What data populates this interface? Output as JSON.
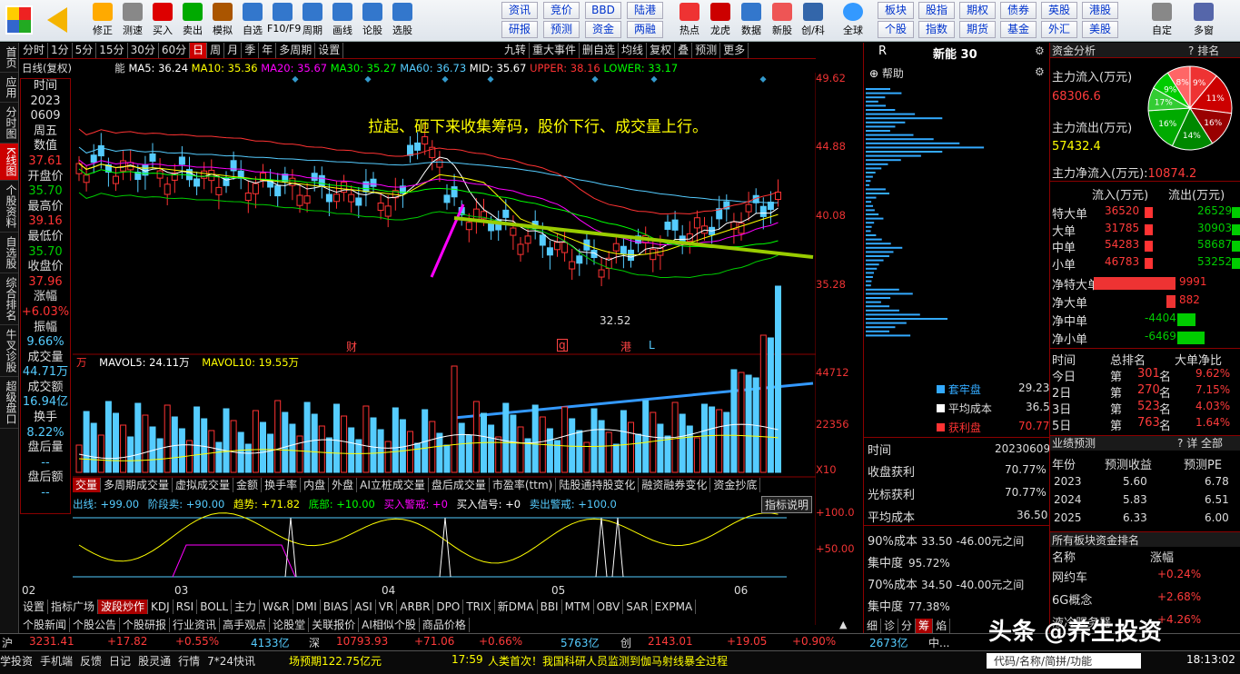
{
  "toolbar": {
    "buttons": [
      "修正",
      "测速",
      "买入",
      "卖出",
      "模拟",
      "自选",
      "F10/F9",
      "周期",
      "画线",
      "论股",
      "选股"
    ],
    "grid": [
      [
        "资讯",
        "竞价",
        "BBD",
        "陆港"
      ],
      [
        "研报",
        "预测",
        "资金",
        "两融"
      ]
    ],
    "right_buttons": [
      "热点",
      "龙虎",
      "数据",
      "新股",
      "创/科"
    ],
    "grid2": [
      [
        "板块",
        "股指",
        "期权",
        "债券",
        "英股",
        "港股"
      ],
      [
        "个股",
        "指数",
        "期货",
        "基金",
        "外汇",
        "美股"
      ]
    ],
    "far": [
      "全球",
      "自定",
      "多窗"
    ]
  },
  "leftnav": [
    "首页",
    "应用",
    "分时图",
    "K线图",
    "个股资料",
    "自选股",
    "综合排名",
    "牛叉诊股",
    "超级盘口"
  ],
  "stats": {
    "time_label": "时间",
    "year": "2023",
    "date": "0609",
    "weekday": "周五",
    "close_label": "数值",
    "close_val": "37.61",
    "open_label": "开盘价",
    "open_val": "35.70",
    "high_label": "最高价",
    "high_val": "39.16",
    "low_label": "最低价",
    "low_val": "35.70",
    "cls_label": "收盘价",
    "cls_val": "37.96",
    "chg_label": "涨幅",
    "chg_val": "+6.03%",
    "amp_label": "振幅",
    "amp_val": "9.66%",
    "vol_label": "成交量",
    "vol_val": "44.71万",
    "amt_label": "成交额",
    "amt_val": "16.94亿",
    "turn_label": "换手",
    "turn_val": "8.22%",
    "after_vol_label": "盘后量",
    "after_vol_val": "--",
    "after_amt_label": "盘后额",
    "after_amt_val": "--"
  },
  "period_tabs": [
    "分时",
    "1分",
    "5分",
    "15分",
    "30分",
    "60分",
    "日",
    "周",
    "月",
    "季",
    "年",
    "多周期",
    "设置"
  ],
  "right_tabs": [
    "九转",
    "重大事件",
    "删自选",
    "均线",
    "复权",
    "叠",
    "预测",
    "更多"
  ],
  "ma_line": {
    "prefix": "日线(复权)",
    "name": "能",
    "ma5": "MA5: 36.24",
    "ma10": "MA10: 35.36",
    "ma20": "MA20: 35.67",
    "ma30": "MA30: 35.27",
    "ma60": "MA60: 36.73",
    "mid": "MID: 35.67",
    "upper": "UPPER: 38.16",
    "lower": "LOWER: 33.17"
  },
  "price_axis": [
    "49.62",
    "44.88",
    "40.08",
    "35.28"
  ],
  "annotation": "拉起、砸下来收集筹码，股价下行、成交量上行。",
  "low_mark": "32.52",
  "markers": [
    "财",
    "q",
    "港",
    "L"
  ],
  "vol_line": {
    "unit": "万",
    "mavol5": "MAVOL5: 24.11万",
    "mavol10": "MAVOL10: 19.55万"
  },
  "vol_axis": [
    "44712",
    "22356",
    "X10"
  ],
  "vol_tabs": [
    "交量",
    "多周期成交量",
    "虚拟成交量",
    "金额",
    "换手率",
    "内盘",
    "外盘",
    "AI立桩成交量",
    "盘后成交量",
    "市盈率(ttm)",
    "陆股通持股变化",
    "融资融券变化",
    "资金抄底"
  ],
  "ind_line": {
    "a": "出线: +99.00",
    "b": "阶段卖: +90.00",
    "c": "趋势: +71.82",
    "d": "底部: +10.00",
    "e": "买入警戒: +0",
    "f": "买入信号: +0",
    "g": "卖出警戒: +100.0",
    "btn": "指标说明"
  },
  "ind_axis": [
    "+100.0",
    "+50.00"
  ],
  "months": [
    "02",
    "03",
    "04",
    "05",
    "06"
  ],
  "ind_tabs": [
    "设置",
    "指标广场",
    "波段炒作",
    "KDJ",
    "RSI",
    "BOLL",
    "主力",
    "W&R",
    "DMI",
    "BIAS",
    "ASI",
    "VR",
    "ARBR",
    "DPO",
    "TRIX",
    "新DMA",
    "BBI",
    "MTM",
    "OBV",
    "SAR",
    "EXPMA"
  ],
  "news_tabs": [
    "个股新闻",
    "个股公告",
    "个股研报",
    "行业资讯",
    "高手观点",
    "论股堂",
    "关联报价",
    "AI相似个股",
    "商品价格"
  ],
  "chip": {
    "title": "新能 30",
    "help": "帮助",
    "legend": [
      [
        "套牢盘",
        "29.23%"
      ],
      [
        "平均成本",
        "36.50"
      ],
      [
        "获利盘",
        "70.77%"
      ]
    ],
    "time_label": "时间",
    "time_val": "20230609",
    "p1_label": "收盘获利",
    "p1": "70.77%",
    "p2_label": "光标获利",
    "p2": "70.77%",
    "avg_label": "平均成本",
    "avg": "36.50",
    "c90": "90%成本",
    "c90a": "33.50",
    "c90b": "-46.00元之间",
    "c90c": "集中度",
    "c90d": "95.72%",
    "c70": "70%成本",
    "c70a": "34.50",
    "c70b": "-40.00元之间",
    "c70c": "集中度",
    "c70d": "77.38%"
  },
  "fund": {
    "title": "资金分析",
    "rank": "排名",
    "in_label": "主力流入(万元)",
    "in_val": "68306.6",
    "out_label": "主力流出(万元)",
    "out_val": "57432.4",
    "net_label": "主力净流入(万元):",
    "net_val": "10874.2",
    "pie": [
      "9%",
      "11%",
      "16%",
      "14%",
      "16%",
      "17%",
      "9%",
      "8%"
    ],
    "hdr": [
      "流入(万元)",
      "流出(万元)"
    ],
    "rows": [
      [
        "特大单",
        "36520",
        "26529"
      ],
      [
        "大单",
        "31785",
        "30903"
      ],
      [
        "中单",
        "54283",
        "58687"
      ],
      [
        "小单",
        "46783",
        "53252"
      ]
    ],
    "net": [
      [
        "净特大单",
        "9991"
      ],
      [
        "净大单",
        "882"
      ],
      [
        "净中单",
        "-4404"
      ],
      [
        "净小单",
        "-6469"
      ]
    ],
    "rank_hdr": [
      "时间",
      "总排名",
      "大单净比"
    ],
    "ranks": [
      [
        "今日",
        "第",
        "301",
        "名",
        "9.62%"
      ],
      [
        "2日",
        "第",
        "270",
        "名",
        "7.15%"
      ],
      [
        "3日",
        "第",
        "523",
        "名",
        "4.03%"
      ],
      [
        "5日",
        "第",
        "763",
        "名",
        "1.64%"
      ]
    ],
    "fc_title": "业绩预测",
    "fc_btn": "详 全部",
    "fc_hdr": [
      "年份",
      "预测收益",
      "预测PE"
    ],
    "fc": [
      [
        "2023",
        "5.60",
        "6.78"
      ],
      [
        "2024",
        "5.83",
        "6.51"
      ],
      [
        "2025",
        "6.33",
        "6.00"
      ]
    ],
    "sec_title": "所有板块资金排名",
    "sec_hdr": [
      "名称",
      "涨幅"
    ],
    "sec": [
      [
        "网约车",
        "+0.24%"
      ],
      [
        "6G概念",
        "+2.68%"
      ],
      [
        "液冷服务器",
        "+4.26%"
      ]
    ]
  },
  "chip_tabs": [
    "细",
    "诊",
    "分",
    "筹",
    "焰"
  ],
  "status": {
    "sh": "沪",
    "sh_idx": "3231.41",
    "sh_chg": "+17.82",
    "sh_pct": "+0.55%",
    "sh_amt": "4133亿",
    "sz": "深",
    "sz_idx": "10793.93",
    "sz_chg": "+71.06",
    "sz_pct": "+0.66%",
    "sz_amt": "5763亿",
    "cy": "创",
    "cy_idx": "2143.01",
    "cy_chg": "+19.05",
    "cy_pct": "+0.90%",
    "cy_amt": "2673亿",
    "mid": "中..."
  },
  "bottom": {
    "items": [
      "学投资",
      "手机端",
      "反馈",
      "日记",
      "股灵通",
      "行情",
      "7*24快讯"
    ],
    "ticker": "场预期122.75亿元",
    "news_time": "17:59",
    "news": "人类首次！我国科研人员监测到伽马射线暴全过程",
    "search": "代码/名称/简拼/功能",
    "clock": "18:13:02",
    "watermark": "头条 @养生投资"
  },
  "chart_data": {
    "type": "candlestick",
    "title": "",
    "price_axis_ticks": [
      49.62,
      44.88,
      40.08,
      35.28
    ],
    "volume_axis_ticks": [
      44712,
      22356
    ],
    "x_months": [
      "02",
      "03",
      "04",
      "05",
      "06"
    ],
    "last": {
      "open": 35.7,
      "high": 39.16,
      "low": 35.7,
      "close": 37.96,
      "volume_wan": 44.71
    },
    "low_mark": 32.52
  }
}
